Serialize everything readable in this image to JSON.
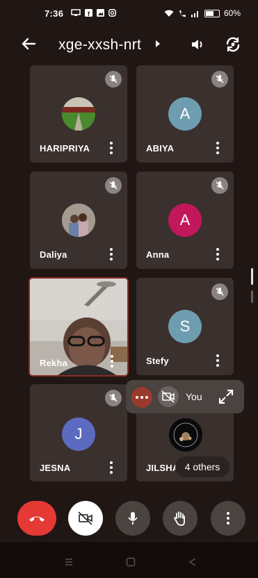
{
  "status_bar": {
    "time": "7:36",
    "battery": "60%"
  },
  "header": {
    "meeting_code": "xge-xxsh-nrt"
  },
  "participants": [
    {
      "name": "HARIPRIYA",
      "avatar_type": "photo",
      "muted": true
    },
    {
      "name": "ABIYA",
      "avatar_type": "letter",
      "initial": "A",
      "color": "#6f9db0",
      "muted": true
    },
    {
      "name": "Daliya",
      "avatar_type": "photo",
      "muted": true
    },
    {
      "name": "Anna",
      "avatar_type": "letter",
      "initial": "A",
      "color": "#c2185b",
      "muted": true
    },
    {
      "name": "Rekha",
      "avatar_type": "video",
      "muted": false,
      "active_speaker": true
    },
    {
      "name": "Stefy",
      "avatar_type": "letter",
      "initial": "S",
      "color": "#6f9db0",
      "muted": true
    },
    {
      "name": "JESNA",
      "avatar_type": "letter",
      "initial": "J",
      "color": "#5c6bc0",
      "muted": true
    },
    {
      "name": "JILSHA",
      "avatar_type": "photo",
      "muted": false
    }
  ],
  "self_view": {
    "label": "You",
    "camera_off": true
  },
  "others_badge": "4 others",
  "controls": [
    {
      "name": "end-call",
      "icon": "phone-hangup-icon",
      "color": "#e53935"
    },
    {
      "name": "camera",
      "icon": "camera-off-icon",
      "color": "#ffffff"
    },
    {
      "name": "microphone",
      "icon": "mic-icon",
      "color": "#4a4340"
    },
    {
      "name": "raise-hand",
      "icon": "hand-icon",
      "color": "#4a4340"
    },
    {
      "name": "more",
      "icon": "more-vertical-icon",
      "color": "#4a4340"
    }
  ],
  "colors": {
    "background": "#201715",
    "tile": "#3a302d",
    "active_border": "#8a2b22",
    "end_call": "#e53935"
  }
}
